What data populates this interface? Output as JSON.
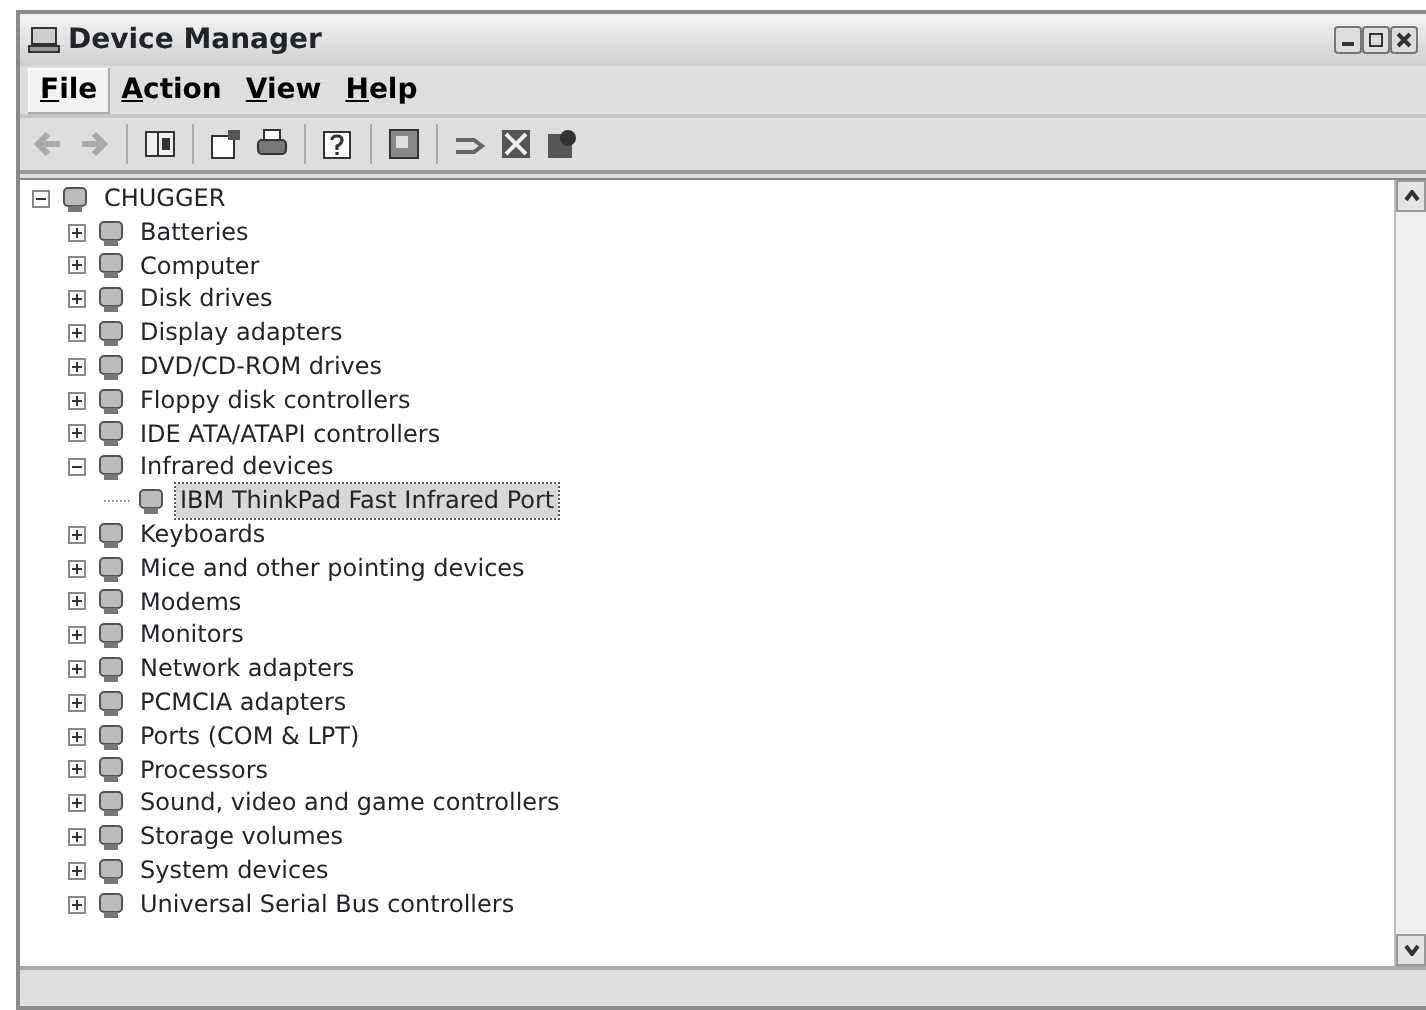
{
  "window": {
    "title": "Device Manager"
  },
  "menu": [
    {
      "label": "File",
      "selected": true
    },
    {
      "label": "Action",
      "selected": false
    },
    {
      "label": "View",
      "selected": false
    },
    {
      "label": "Help",
      "selected": false
    }
  ],
  "tree": {
    "label": "CHUGGER",
    "expanded": true,
    "selected": false,
    "children": [
      {
        "label": "Batteries",
        "expanded": false,
        "selected": false
      },
      {
        "label": "Computer",
        "expanded": false,
        "selected": false
      },
      {
        "label": "Disk drives",
        "expanded": false,
        "selected": false
      },
      {
        "label": "Display adapters",
        "expanded": false,
        "selected": false
      },
      {
        "label": "DVD/CD-ROM drives",
        "expanded": false,
        "selected": false
      },
      {
        "label": "Floppy disk controllers",
        "expanded": false,
        "selected": false
      },
      {
        "label": "IDE ATA/ATAPI controllers",
        "expanded": false,
        "selected": false
      },
      {
        "label": "Infrared devices",
        "expanded": true,
        "selected": false,
        "children": [
          {
            "label": "IBM ThinkPad Fast Infrared Port",
            "selected": true
          }
        ]
      },
      {
        "label": "Keyboards",
        "expanded": false,
        "selected": false
      },
      {
        "label": "Mice and other pointing devices",
        "expanded": false,
        "selected": false
      },
      {
        "label": "Modems",
        "expanded": false,
        "selected": false
      },
      {
        "label": "Monitors",
        "expanded": false,
        "selected": false
      },
      {
        "label": "Network adapters",
        "expanded": false,
        "selected": false
      },
      {
        "label": "PCMCIA adapters",
        "expanded": false,
        "selected": false
      },
      {
        "label": "Ports (COM & LPT)",
        "expanded": false,
        "selected": false
      },
      {
        "label": "Processors",
        "expanded": false,
        "selected": false
      },
      {
        "label": "Sound, video and game controllers",
        "expanded": false,
        "selected": false
      },
      {
        "label": "Storage volumes",
        "expanded": false,
        "selected": false
      },
      {
        "label": "System devices",
        "expanded": false,
        "selected": false
      },
      {
        "label": "Universal Serial Bus controllers",
        "expanded": false,
        "selected": false
      }
    ]
  }
}
